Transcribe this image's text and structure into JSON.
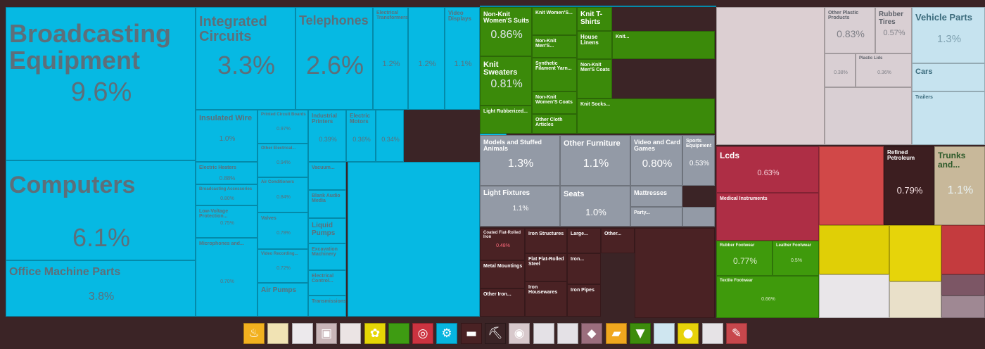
{
  "chart_data": {
    "type": "treemap",
    "colors": {
      "machines": "#06b9e3",
      "textiles": "#3b8a0a",
      "misc": "#939aa6",
      "metals": "#4a2224",
      "plastics": "#d9cfd3",
      "transport": "#c6e3ef",
      "instruments": "#ae2e45",
      "footwear": "#3f9a0c",
      "chemicals": "#d14848",
      "minerals": "#3c1e20",
      "animal_hides": "#c8b89a",
      "vegetable": "#e0cf06",
      "stone_glass": "#e9e6e9",
      "other": "#7c5665"
    },
    "items": [
      {
        "name": "Broadcasting Equipment",
        "share": "9.6%",
        "value": 9.6,
        "group": "machines"
      },
      {
        "name": "Computers",
        "share": "6.1%",
        "value": 6.1,
        "group": "machines"
      },
      {
        "name": "Office Machine Parts",
        "share": "3.8%",
        "value": 3.8,
        "group": "machines"
      },
      {
        "name": "Integrated Circuits",
        "share": "3.3%",
        "value": 3.3,
        "group": "machines"
      },
      {
        "name": "Telephones",
        "share": "2.6%",
        "value": 2.6,
        "group": "machines"
      },
      {
        "name": "Electrical Transformers",
        "share": "1.2%",
        "value": 1.2,
        "group": "machines"
      },
      {
        "name": "",
        "share": "1.2%",
        "value": 1.2,
        "group": "machines"
      },
      {
        "name": "Video Displays",
        "share": "1.1%",
        "value": 1.1,
        "group": "machines"
      },
      {
        "name": "Insulated Wire",
        "share": "1.0%",
        "value": 1.0,
        "group": "machines"
      },
      {
        "name": "Printed Circuit Boards",
        "share": "0.97%",
        "value": 0.97,
        "group": "machines"
      },
      {
        "name": "Other Electrical...",
        "share": "0.94%",
        "value": 0.94,
        "group": "machines"
      },
      {
        "name": "Electric Heaters",
        "share": "0.88%",
        "value": 0.88,
        "group": "machines"
      },
      {
        "name": "Air Conditioners",
        "share": "0.84%",
        "value": 0.84,
        "group": "machines"
      },
      {
        "name": "Broadcasting Accessories",
        "share": "0.80%",
        "value": 0.8,
        "group": "machines"
      },
      {
        "name": "Valves",
        "share": "0.78%",
        "value": 0.78,
        "group": "machines"
      },
      {
        "name": "Low-Voltage Protection...",
        "share": "0.75%",
        "value": 0.75,
        "group": "machines"
      },
      {
        "name": "Video Recording...",
        "share": "0.72%",
        "value": 0.72,
        "group": "machines"
      },
      {
        "name": "Microphones and...",
        "share": "0.70%",
        "value": 0.7,
        "group": "machines"
      },
      {
        "name": "Air Pumps",
        "share": "",
        "value": 0.6,
        "group": "machines"
      },
      {
        "name": "Industrial Printers",
        "share": "0.39%",
        "value": 0.39,
        "group": "machines"
      },
      {
        "name": "Electric Motors",
        "share": "0.36%",
        "value": 0.36,
        "group": "machines"
      },
      {
        "name": "",
        "share": "0.34%",
        "value": 0.34,
        "group": "machines"
      },
      {
        "name": "Vacuum...",
        "share": "",
        "value": 0.3,
        "group": "machines"
      },
      {
        "name": "Blank Audio Media",
        "share": "",
        "value": 0.3,
        "group": "machines"
      },
      {
        "name": "Liquid Pumps",
        "share": "",
        "value": 0.3,
        "group": "machines"
      },
      {
        "name": "Excavation Machinery",
        "share": "",
        "value": 0.3,
        "group": "machines"
      },
      {
        "name": "Electrical Control...",
        "share": "",
        "value": 0.3,
        "group": "machines"
      },
      {
        "name": "Transmissions",
        "share": "",
        "value": 0.3,
        "group": "machines"
      },
      {
        "name": "Non-Knit Women'S Suits",
        "share": "0.86%",
        "value": 0.86,
        "group": "textiles"
      },
      {
        "name": "Knit Women'S...",
        "share": "",
        "value": 0.3,
        "group": "textiles"
      },
      {
        "name": "Knit T-Shirts",
        "share": "",
        "value": 0.4,
        "group": "textiles"
      },
      {
        "name": "Non-Knit Men'S...",
        "share": "",
        "value": 0.3,
        "group": "textiles"
      },
      {
        "name": "House Linens",
        "share": "",
        "value": 0.3,
        "group": "textiles"
      },
      {
        "name": "Knit...",
        "share": "",
        "value": 0.3,
        "group": "textiles"
      },
      {
        "name": "Knit Sweaters",
        "share": "0.81%",
        "value": 0.81,
        "group": "textiles"
      },
      {
        "name": "Synthetic Filament Yarn...",
        "share": "",
        "value": 0.3,
        "group": "textiles"
      },
      {
        "name": "Non-Knit Men'S Coats",
        "share": "",
        "value": 0.3,
        "group": "textiles"
      },
      {
        "name": "Non-Knit Women'S Coats",
        "share": "",
        "value": 0.3,
        "group": "textiles"
      },
      {
        "name": "Light Rubberized...",
        "share": "",
        "value": 0.3,
        "group": "textiles"
      },
      {
        "name": "Other Cloth Articles",
        "share": "",
        "value": 0.3,
        "group": "textiles"
      },
      {
        "name": "Knit Socks...",
        "share": "",
        "value": 0.3,
        "group": "textiles"
      },
      {
        "name": "Models and Stuffed Animals",
        "share": "1.3%",
        "value": 1.3,
        "group": "misc"
      },
      {
        "name": "Other Furniture",
        "share": "1.1%",
        "value": 1.1,
        "group": "misc"
      },
      {
        "name": "Video and Card Games",
        "share": "0.80%",
        "value": 0.8,
        "group": "misc"
      },
      {
        "name": "Sports Equipment",
        "share": "0.53%",
        "value": 0.53,
        "group": "misc"
      },
      {
        "name": "Light Fixtures",
        "share": "1.1%",
        "value": 1.1,
        "group": "misc"
      },
      {
        "name": "Seats",
        "share": "1.0%",
        "value": 1.0,
        "group": "misc"
      },
      {
        "name": "Mattresses",
        "share": "",
        "value": 0.5,
        "group": "misc"
      },
      {
        "name": "Party...",
        "share": "",
        "value": 0.3,
        "group": "misc"
      },
      {
        "name": "Coated Flat-Rolled Iron",
        "share": "0.48%",
        "value": 0.48,
        "group": "metals"
      },
      {
        "name": "Iron Structures",
        "share": "",
        "value": 0.3,
        "group": "metals"
      },
      {
        "name": "Large...",
        "share": "",
        "value": 0.3,
        "group": "metals"
      },
      {
        "name": "Other...",
        "share": "",
        "value": 0.3,
        "group": "metals"
      },
      {
        "name": "Metal Mountings",
        "share": "",
        "value": 0.3,
        "group": "metals"
      },
      {
        "name": "Flat Flat-Rolled Steel",
        "share": "",
        "value": 0.3,
        "group": "metals"
      },
      {
        "name": "Iron...",
        "share": "",
        "value": 0.3,
        "group": "metals"
      },
      {
        "name": "Iron Housewares",
        "share": "",
        "value": 0.3,
        "group": "metals"
      },
      {
        "name": "Iron Pipes",
        "share": "",
        "value": 0.3,
        "group": "metals"
      },
      {
        "name": "Other Iron...",
        "share": "",
        "value": 0.3,
        "group": "metals"
      },
      {
        "name": "Other Plastic Products",
        "share": "0.83%",
        "value": 0.83,
        "group": "plastics"
      },
      {
        "name": "Rubber Tires",
        "share": "0.57%",
        "value": 0.57,
        "group": "plastics"
      },
      {
        "name": "Plastic Lids",
        "share": "0.36%",
        "value": 0.36,
        "group": "plastics"
      },
      {
        "name": "",
        "share": "0.38%",
        "value": 0.38,
        "group": "plastics"
      },
      {
        "name": "Vehicle Parts",
        "share": "1.3%",
        "value": 1.3,
        "group": "transport"
      },
      {
        "name": "Cars",
        "share": "",
        "value": 0.6,
        "group": "transport"
      },
      {
        "name": "Trailers",
        "share": "",
        "value": 0.3,
        "group": "transport"
      },
      {
        "name": "Lcds",
        "share": "0.63%",
        "value": 0.63,
        "group": "instruments"
      },
      {
        "name": "Medical Instruments",
        "share": "",
        "value": 0.3,
        "group": "instruments"
      },
      {
        "name": "Rubber Footwear",
        "share": "0.77%",
        "value": 0.77,
        "group": "footwear"
      },
      {
        "name": "Leather Footwear",
        "share": "0.5%",
        "value": 0.5,
        "group": "footwear"
      },
      {
        "name": "Textile Footwear",
        "share": "0.66%",
        "value": 0.66,
        "group": "footwear"
      },
      {
        "name": "Refined Petroleum",
        "share": "0.79%",
        "value": 0.79,
        "group": "minerals"
      },
      {
        "name": "Trunks and...",
        "share": "1.1%",
        "value": 1.1,
        "group": "animal_hides"
      }
    ]
  },
  "legend": {
    "icons": [
      {
        "name": "animal-products-icon",
        "glyph": "♨",
        "color": "#f2b11f"
      },
      {
        "name": "vegetable-products-icon",
        "glyph": "",
        "color": "#f1e3b4"
      },
      {
        "name": "animal-vegetable-fats-icon",
        "glyph": "",
        "color": "#ece9ec"
      },
      {
        "name": "foodstuffs-icon",
        "glyph": "▣",
        "color": "#c9b6b8"
      },
      {
        "name": "mineral-products-icon",
        "glyph": "",
        "color": "#ebe4e4"
      },
      {
        "name": "chemical-products-icon",
        "glyph": "✿",
        "color": "#e6d606"
      },
      {
        "name": "footwear-icon",
        "glyph": "",
        "color": "#3e9c12"
      },
      {
        "name": "instruments-icon",
        "glyph": "◎",
        "color": "#cc3340"
      },
      {
        "name": "machines-icon",
        "glyph": "⚙",
        "color": "#07b5df"
      },
      {
        "name": "metals-icon",
        "glyph": "▬",
        "color": "#4a2224"
      },
      {
        "name": "pickaxe-icon",
        "glyph": "⛏",
        "color": "#3b2426"
      },
      {
        "name": "hides-icon",
        "glyph": "◉",
        "color": "#d8c9cc"
      },
      {
        "name": "precious-metals-icon",
        "glyph": "",
        "color": "#e4e1e6"
      },
      {
        "name": "stone-glass-icon",
        "glyph": "",
        "color": "#e4e1e6"
      },
      {
        "name": "gem-icon",
        "glyph": "◆",
        "color": "#9b6e7d"
      },
      {
        "name": "plastics-icon",
        "glyph": "▰",
        "color": "#f0a71e"
      },
      {
        "name": "textiles-icon",
        "glyph": "▼",
        "color": "#3d8c0c"
      },
      {
        "name": "transport-icon",
        "glyph": "",
        "color": "#cfe6f0"
      },
      {
        "name": "weapons-icon",
        "glyph": "●",
        "color": "#e7d20a"
      },
      {
        "name": "paper-icon",
        "glyph": "",
        "color": "#e6e3e6"
      },
      {
        "name": "miscellaneous-icon",
        "glyph": "✎",
        "color": "#c7474c"
      }
    ]
  }
}
